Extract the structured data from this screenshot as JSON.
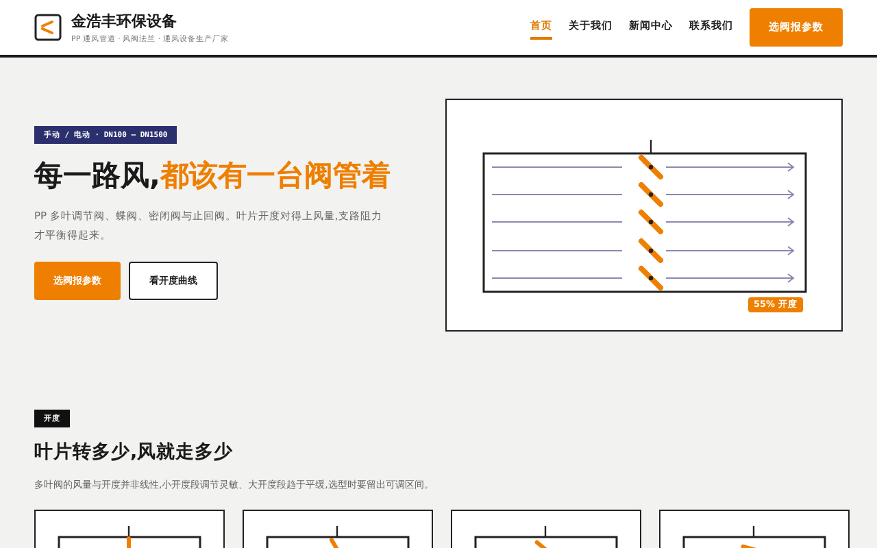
{
  "header": {
    "brand": "金浩丰环保设备",
    "tagline": "PP 通风管道 · 风阀法兰 · 通风设备生产厂家",
    "nav": [
      {
        "label": "首页",
        "selected": true
      },
      {
        "label": "关于我们",
        "selected": false
      },
      {
        "label": "新闻中心",
        "selected": false
      },
      {
        "label": "联系我们",
        "selected": false
      }
    ],
    "cta": "选阀报参数"
  },
  "hero": {
    "tag": "手动 / 电动 · DN100 — DN1500",
    "title_plain": "每一路风,",
    "title_accent": "都该有一台阀管着",
    "lead": "PP 多叶调节阀、蝶阀、密闭阀与止回阀。叶片开度对得上风量,支路阻力才平衡得起来。",
    "buttons": [
      {
        "label": "选阀报参数",
        "kind": "primary"
      },
      {
        "label": "看开度曲线",
        "kind": "outline"
      }
    ],
    "badge": "55% 开度"
  },
  "section": {
    "tag": "开度",
    "title": "叶片转多少,风就走多少",
    "lead": "多叶阀的风量与开度并非线性,小开度段调节灵敏、大开度段趋于平缓,选型时要留出可调区间。"
  }
}
